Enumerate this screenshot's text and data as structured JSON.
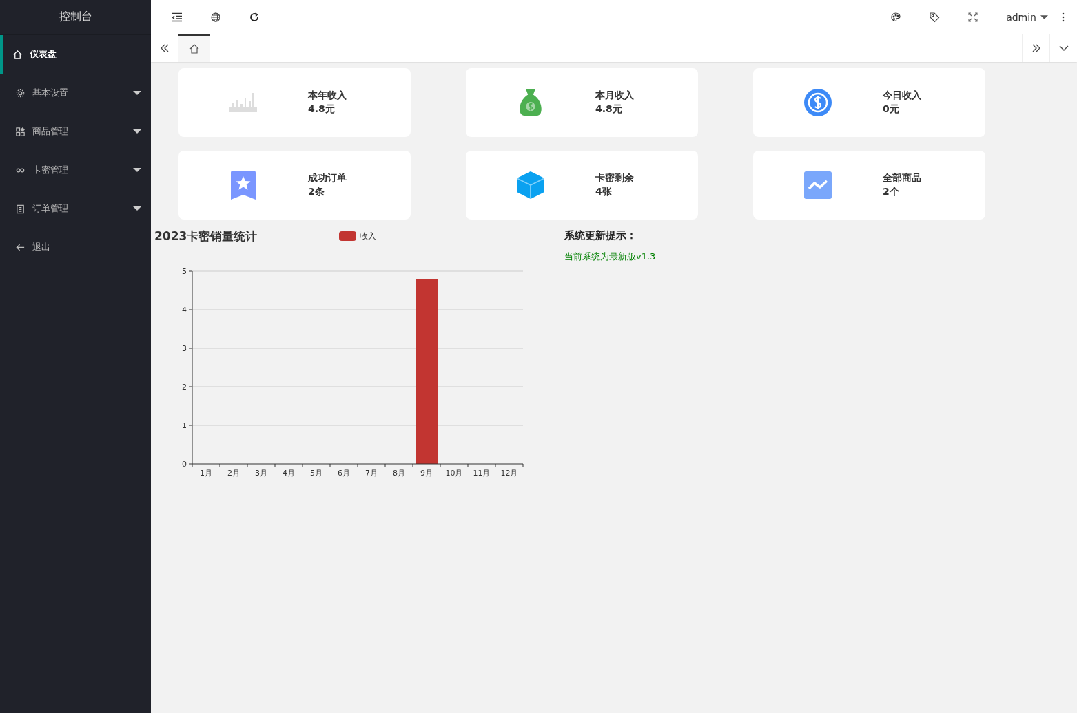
{
  "sidebar": {
    "title": "控制台",
    "items": [
      {
        "label": "仪表盘",
        "kind": "home",
        "selected": true,
        "submenu": false
      },
      {
        "label": "基本设置",
        "kind": "gear",
        "selected": false,
        "submenu": true
      },
      {
        "label": "商品管理",
        "kind": "grid",
        "selected": false,
        "submenu": true
      },
      {
        "label": "卡密管理",
        "kind": "link",
        "selected": false,
        "submenu": true
      },
      {
        "label": "订单管理",
        "kind": "clipboard",
        "selected": false,
        "submenu": true
      },
      {
        "label": "退出",
        "kind": "back",
        "selected": false,
        "submenu": false
      }
    ]
  },
  "header": {
    "user": "admin"
  },
  "tabs": [
    {
      "kind": "home",
      "selected": true
    }
  ],
  "stats": [
    {
      "kind": "bars",
      "label": "本年收入",
      "value": "4.8元"
    },
    {
      "kind": "moneybag",
      "label": "本月收入",
      "value": "4.8元"
    },
    {
      "kind": "coin",
      "label": "今日收入",
      "value": "0元"
    },
    {
      "kind": "bookmark",
      "label": "成功订单",
      "value": "2条"
    },
    {
      "kind": "cube",
      "label": "卡密剩余",
      "value": "4张"
    },
    {
      "kind": "trend",
      "label": "全部商品",
      "value": "2个"
    }
  ],
  "sales_chart": {
    "chart_data": {
      "type": "bar",
      "title": "2023卡密销量统计",
      "categories": [
        "1月",
        "2月",
        "3月",
        "4月",
        "5月",
        "6月",
        "7月",
        "8月",
        "9月",
        "10月",
        "11月",
        "12月"
      ],
      "series": [
        {
          "name": "收入",
          "color": "#c23531",
          "values": [
            0,
            0,
            0,
            0,
            0,
            0,
            0,
            0,
            4.8,
            0,
            0,
            0
          ]
        }
      ],
      "ylim": [
        0,
        5
      ],
      "yticks": [
        0,
        1,
        2,
        3,
        4,
        5
      ],
      "grid": true
    }
  },
  "update_notice": {
    "title": "系统更新提示：",
    "message": "当前系统为最新版v1.3"
  }
}
